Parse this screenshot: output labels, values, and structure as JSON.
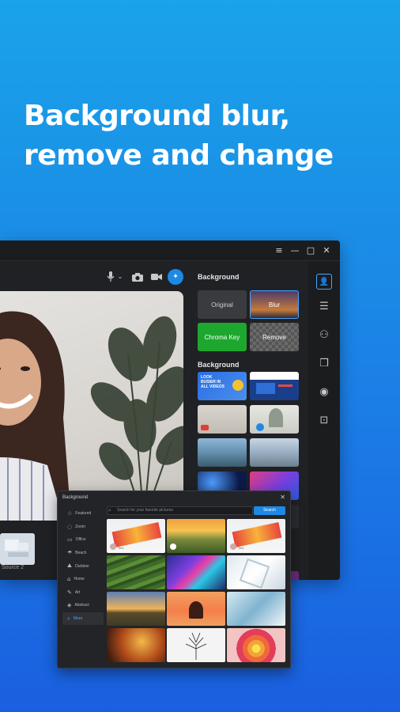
{
  "headline": {
    "line1": "Background blur,",
    "line2": "remove and change"
  },
  "colors": {
    "accent": "#1e88e5",
    "window_bg": "#202124",
    "chroma_green": "#1ea72f"
  },
  "window": {
    "controls": [
      "menu-icon",
      "minimize-icon",
      "maximize-icon",
      "close-icon"
    ],
    "toolbar": [
      "microphone-icon",
      "chevron-down-icon",
      "camera-icon",
      "video-icon",
      "effects-icon"
    ],
    "thumbnail_caption": "Source 2"
  },
  "panel": {
    "header": "Background",
    "modes": [
      "Original",
      "Blur",
      "Chroma Key",
      "Remove"
    ],
    "section": "Background",
    "sidebar_icons": [
      "person-icon",
      "sliders-icon",
      "filters-icon",
      "sticker-icon",
      "mask-icon",
      "capture-icon"
    ],
    "thumbs": [
      {
        "texts": [
          "LOOK",
          "BUSIER IN",
          "ALL VIDEOS"
        ]
      },
      {
        "texts": []
      },
      {
        "texts": []
      },
      {
        "texts": []
      },
      {
        "texts": []
      },
      {
        "texts": []
      },
      {
        "texts": []
      },
      {
        "texts": []
      }
    ]
  },
  "dialog": {
    "title": "Background",
    "search_placeholder": "Search for your favorite pictures",
    "search_button": "Search",
    "categories": [
      {
        "icon": "star-icon",
        "label": "Featured"
      },
      {
        "icon": "zoom-icon",
        "label": "Zoom"
      },
      {
        "icon": "office-icon",
        "label": "Office"
      },
      {
        "icon": "beach-icon",
        "label": "Beach"
      },
      {
        "icon": "outdoor-icon",
        "label": "Outdoor"
      },
      {
        "icon": "home-icon",
        "label": "Home"
      },
      {
        "icon": "art-icon",
        "label": "Art"
      },
      {
        "icon": "abstract-icon",
        "label": "Abstract"
      },
      {
        "icon": "search-icon",
        "label": "More"
      }
    ],
    "selected_category": "More",
    "grid_overlays": [
      "Text",
      "",
      "Text"
    ]
  }
}
